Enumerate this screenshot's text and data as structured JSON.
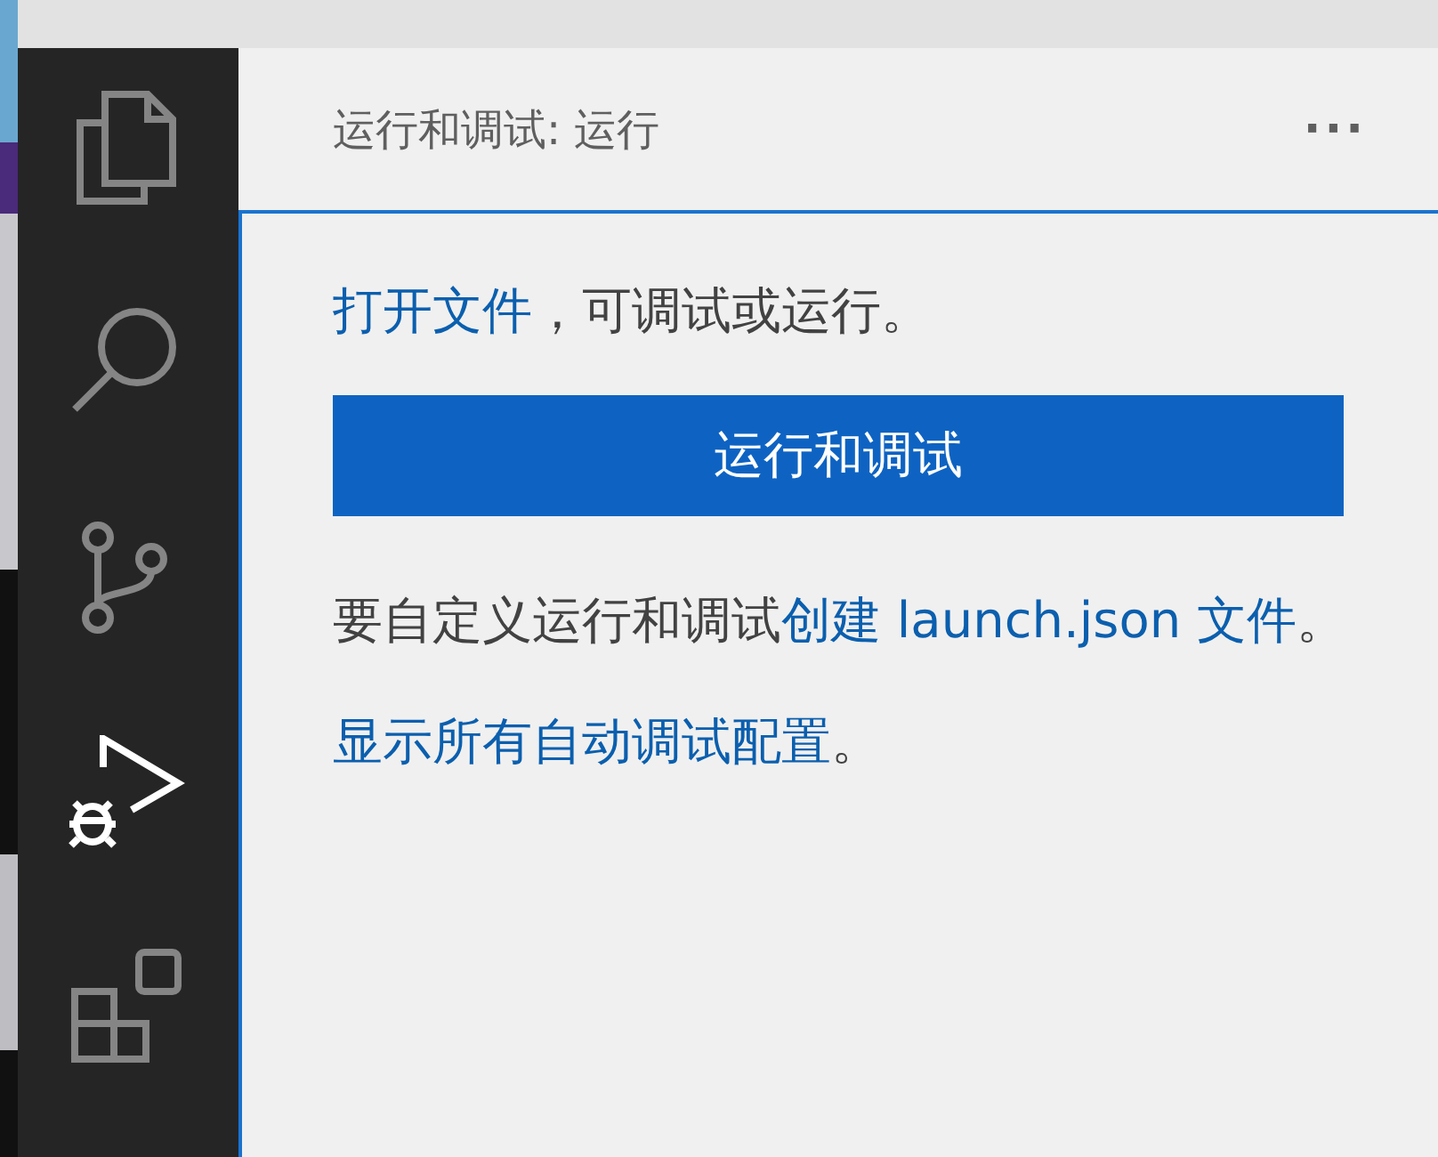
{
  "activity_bar": {
    "items": [
      {
        "kind": "files",
        "selected": false
      },
      {
        "kind": "search",
        "selected": false
      },
      {
        "kind": "branch",
        "selected": false
      },
      {
        "kind": "debug",
        "selected": true
      },
      {
        "kind": "extensions",
        "selected": false
      }
    ]
  },
  "sidebar": {
    "title": "运行和调试: 运行",
    "more": "···",
    "paragraphs": [
      {
        "parts": [
          {
            "kind": "link",
            "text": "打开文件"
          },
          {
            "kind": "text",
            "text": "，可调试或运行。"
          }
        ]
      },
      {
        "kind": "button",
        "text": "运行和调试"
      },
      {
        "parts": [
          {
            "kind": "text",
            "text": "要自定义运行和调试"
          },
          {
            "kind": "link",
            "text": "创建 launch.json 文件"
          },
          {
            "kind": "text",
            "text": "。"
          }
        ]
      },
      {
        "parts": [
          {
            "kind": "link",
            "text": "显示所有自动调试配置"
          },
          {
            "kind": "text",
            "text": "。"
          }
        ]
      }
    ]
  }
}
